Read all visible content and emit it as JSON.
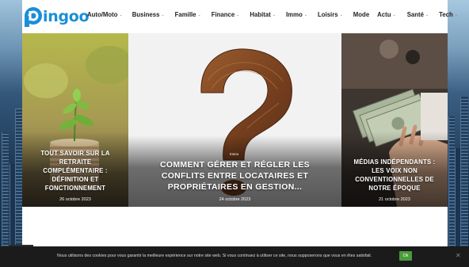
{
  "logo": {
    "text": "ingoo",
    "brand_color": "#1a8fd8"
  },
  "nav": [
    {
      "label": "Auto/Moto",
      "dropdown": true
    },
    {
      "label": "Business",
      "dropdown": true
    },
    {
      "label": "Famille",
      "dropdown": true
    },
    {
      "label": "Finance",
      "dropdown": true
    },
    {
      "label": "Habitat",
      "dropdown": true
    },
    {
      "label": "Immo",
      "dropdown": true
    },
    {
      "label": "Loisirs",
      "dropdown": true
    },
    {
      "label": "Mode",
      "dropdown": false
    },
    {
      "label": "Actu",
      "dropdown": true
    },
    {
      "label": "Santé",
      "dropdown": true
    },
    {
      "label": "Tech",
      "dropdown": true
    }
  ],
  "slides": [
    {
      "title": "Tout savoir sur la retraite complémentaire : définition et fonctionnement",
      "date": "26 octobre 2023",
      "image_icon": "plant-coins-icon"
    },
    {
      "title": "Comment gérer et régler les conflits entre locataires et propriétaires en gestion...",
      "date": "24 octobre 2023",
      "category": "Immo",
      "image_icon": "question-mark-icon"
    },
    {
      "title": "Médias indépendants : les voix non conventionnelles de notre époque",
      "date": "21 octobre 2023",
      "image_icon": "money-hand-icon"
    }
  ],
  "cookie": {
    "text": "Nous utilisons des cookies pour vous garantir la meilleure expérience sur notre site web. Si vous continuez à utiliser ce site, nous supposerons que vous en êtes satisfait.",
    "ok_label": "Ok",
    "close_label": "✕",
    "accent": "#4a9b3b"
  }
}
